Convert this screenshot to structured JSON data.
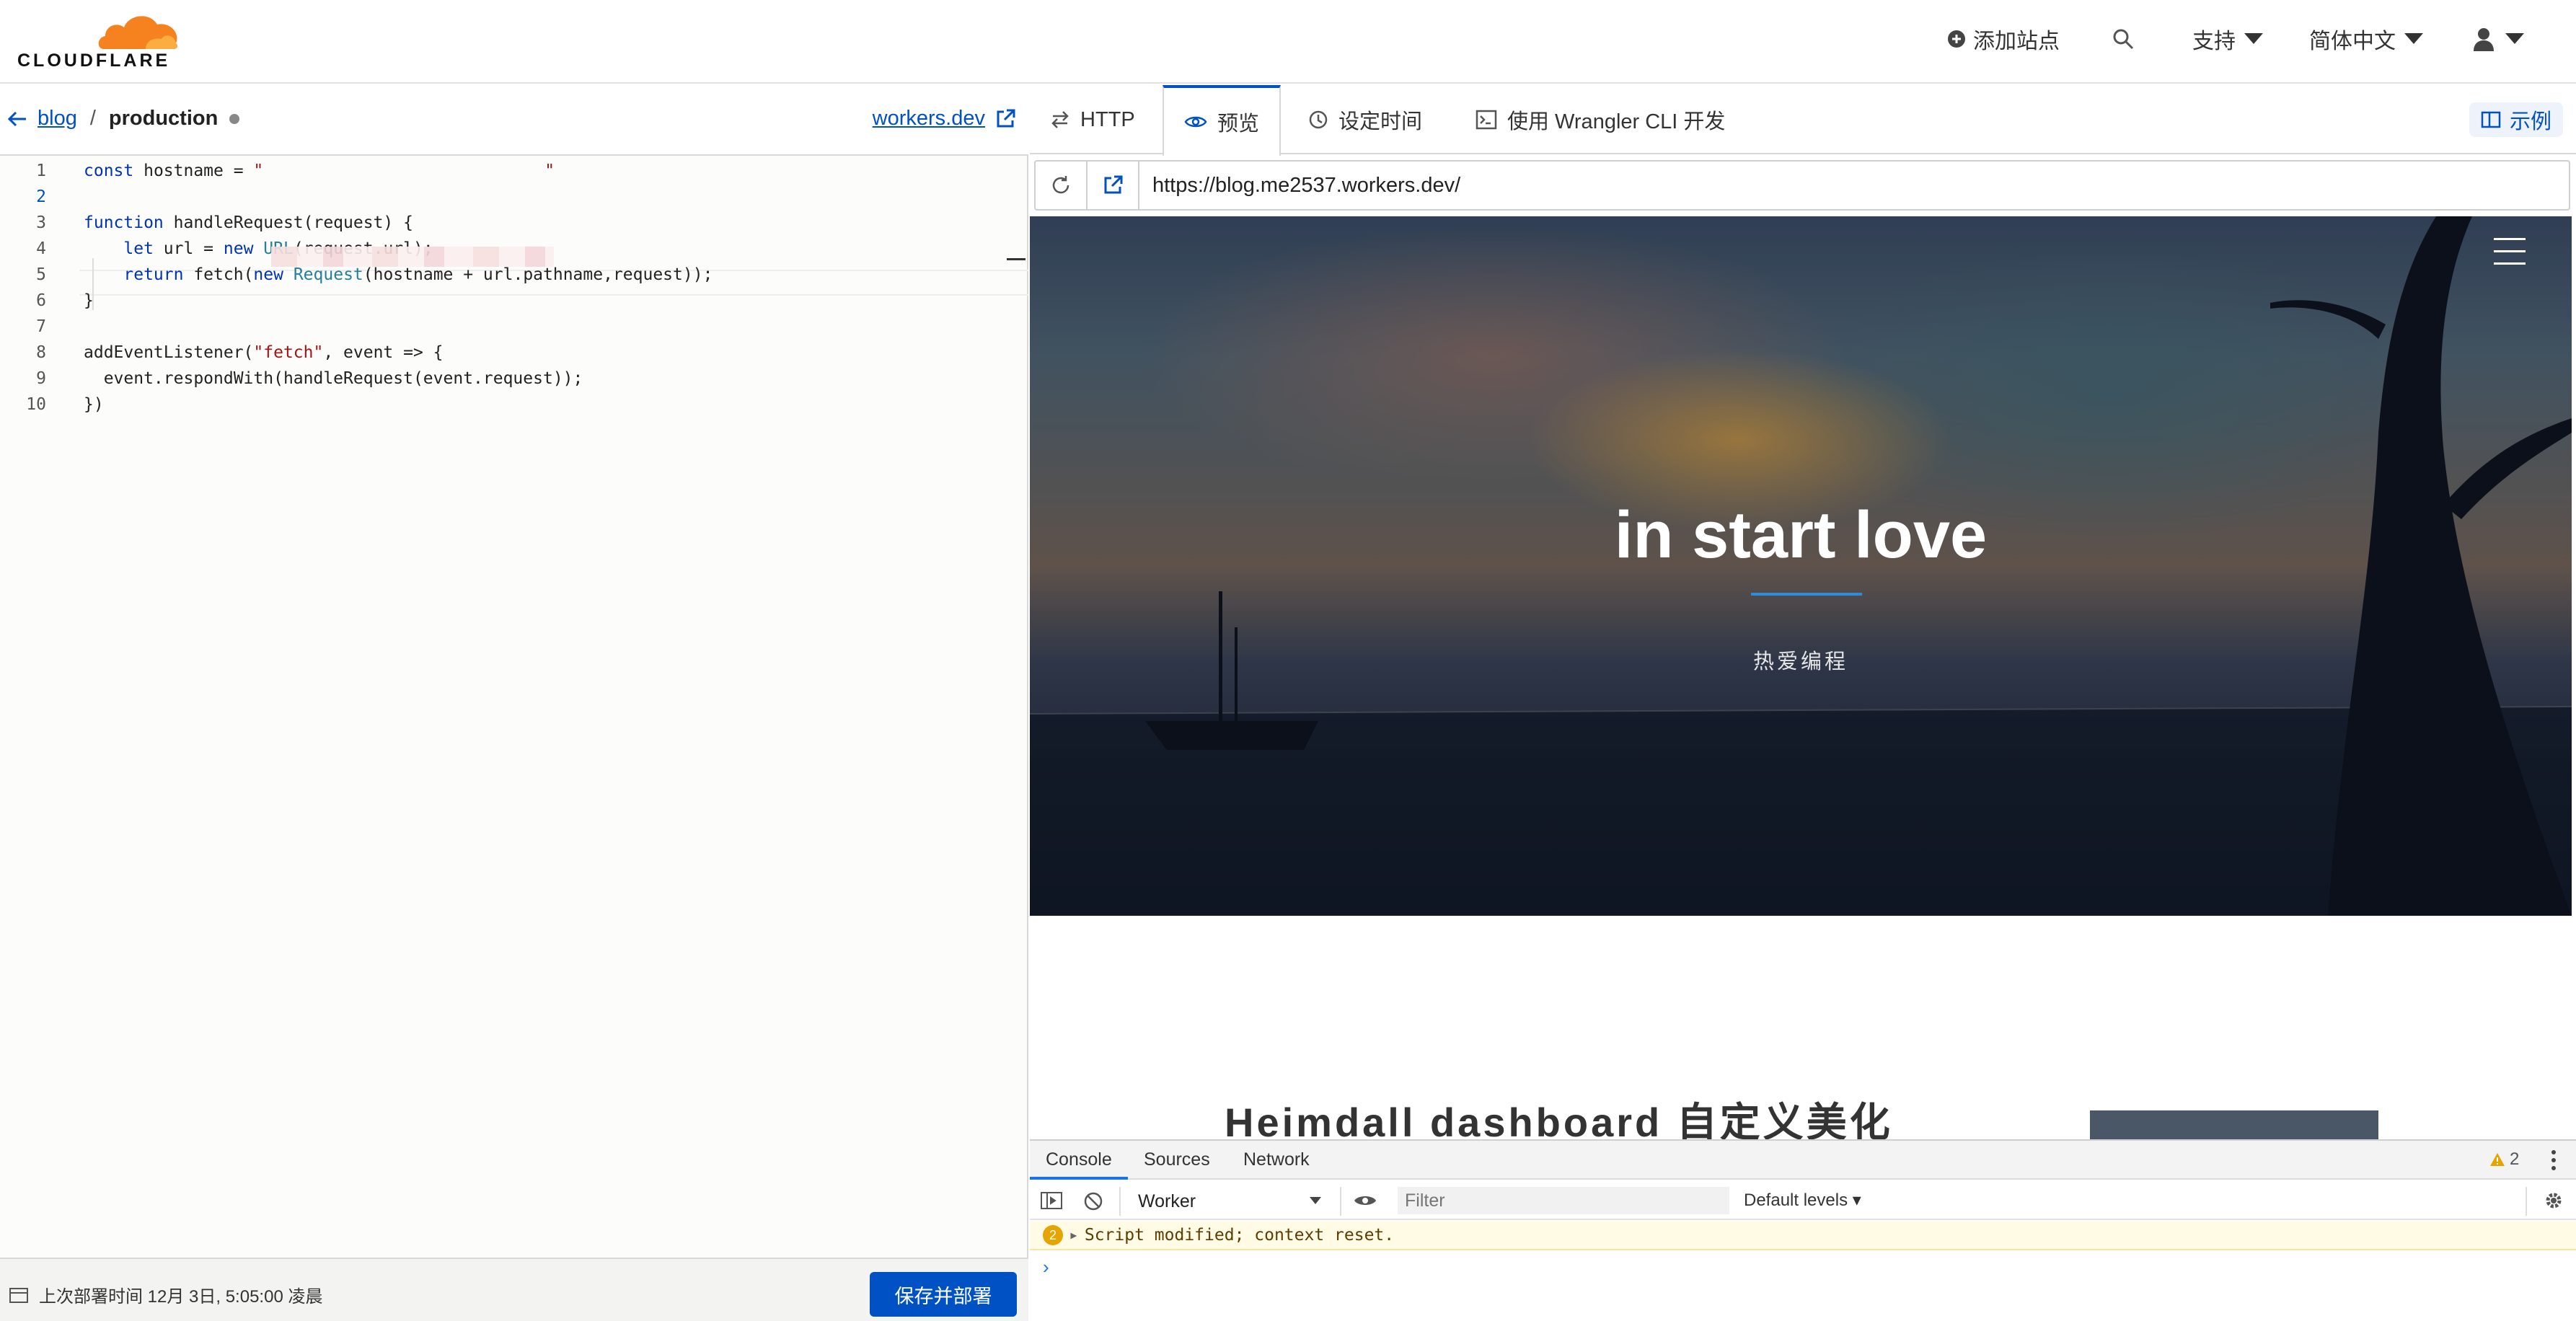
{
  "topnav": {
    "logo_text": "CLOUDFLARE",
    "add_site": "添加站点",
    "support": "支持",
    "language": "简体中文"
  },
  "editor_panel": {
    "breadcrumb": {
      "parent": "blog",
      "separator": "/",
      "current": "production"
    },
    "workers_link": "workers.dev",
    "code_lines": [
      {
        "n": "1",
        "tokens": [
          [
            "kw",
            "const"
          ],
          [
            "p",
            " hostname = "
          ],
          [
            "str",
            "\""
          ],
          [
            "str",
            "\""
          ]
        ]
      },
      {
        "n": "2",
        "tokens": []
      },
      {
        "n": "3",
        "tokens": [
          [
            "kw",
            "function"
          ],
          [
            "p",
            " handleRequest(request) {"
          ]
        ]
      },
      {
        "n": "4",
        "tokens": [
          [
            "p",
            "    "
          ],
          [
            "kw",
            "let"
          ],
          [
            "p",
            " url = "
          ],
          [
            "kw",
            "new"
          ],
          [
            "p",
            " "
          ],
          [
            "cls",
            "URL"
          ],
          [
            "p",
            "(request.url);"
          ]
        ]
      },
      {
        "n": "5",
        "tokens": [
          [
            "p",
            "    "
          ],
          [
            "kw",
            "return"
          ],
          [
            "p",
            " fetch("
          ],
          [
            "kw",
            "new"
          ],
          [
            "p",
            " "
          ],
          [
            "cls",
            "Request"
          ],
          [
            "p",
            "(hostname + url.pathname,request));"
          ]
        ]
      },
      {
        "n": "6",
        "tokens": [
          [
            "p",
            "}"
          ]
        ]
      },
      {
        "n": "7",
        "tokens": []
      },
      {
        "n": "8",
        "tokens": [
          [
            "p",
            "addEventListener("
          ],
          [
            "str",
            "\"fetch\""
          ],
          [
            "p",
            ", event => {"
          ]
        ]
      },
      {
        "n": "9",
        "tokens": [
          [
            "p",
            "  event.respondWith(handleRequest(event.request));"
          ]
        ]
      },
      {
        "n": "10",
        "tokens": [
          [
            "p",
            "})"
          ]
        ]
      }
    ],
    "active_line": "2",
    "footer": {
      "last_deploy": "上次部署时间 12月 3日, 5:05:00 凌晨",
      "save_button": "保存并部署"
    }
  },
  "preview_panel": {
    "tabs": [
      {
        "label": "HTTP",
        "icon": "arrows-exchange-icon"
      },
      {
        "label": "预览",
        "icon": "eye-icon",
        "active": true
      },
      {
        "label": "设定时间",
        "icon": "clock-icon"
      },
      {
        "label": "使用 Wrangler CLI 开发",
        "icon": "terminal-icon"
      }
    ],
    "examples_button": "示例",
    "url": "https://blog.me2537.workers.dev/",
    "site": {
      "hero_title": "in start love",
      "hero_subtitle": "热爱编程",
      "post_title": "Heimdall dashboard 自定义美化"
    }
  },
  "console": {
    "tabs": [
      "Console",
      "Sources",
      "Network"
    ],
    "warning_count": "2",
    "context": "Worker",
    "filter_placeholder": "Filter",
    "levels": "Default levels",
    "message_count": "2",
    "message": "Script modified; context reset.",
    "prompt": "›"
  },
  "colors": {
    "accent": "#0051c3",
    "cloudflare_orange": "#f6821f"
  }
}
